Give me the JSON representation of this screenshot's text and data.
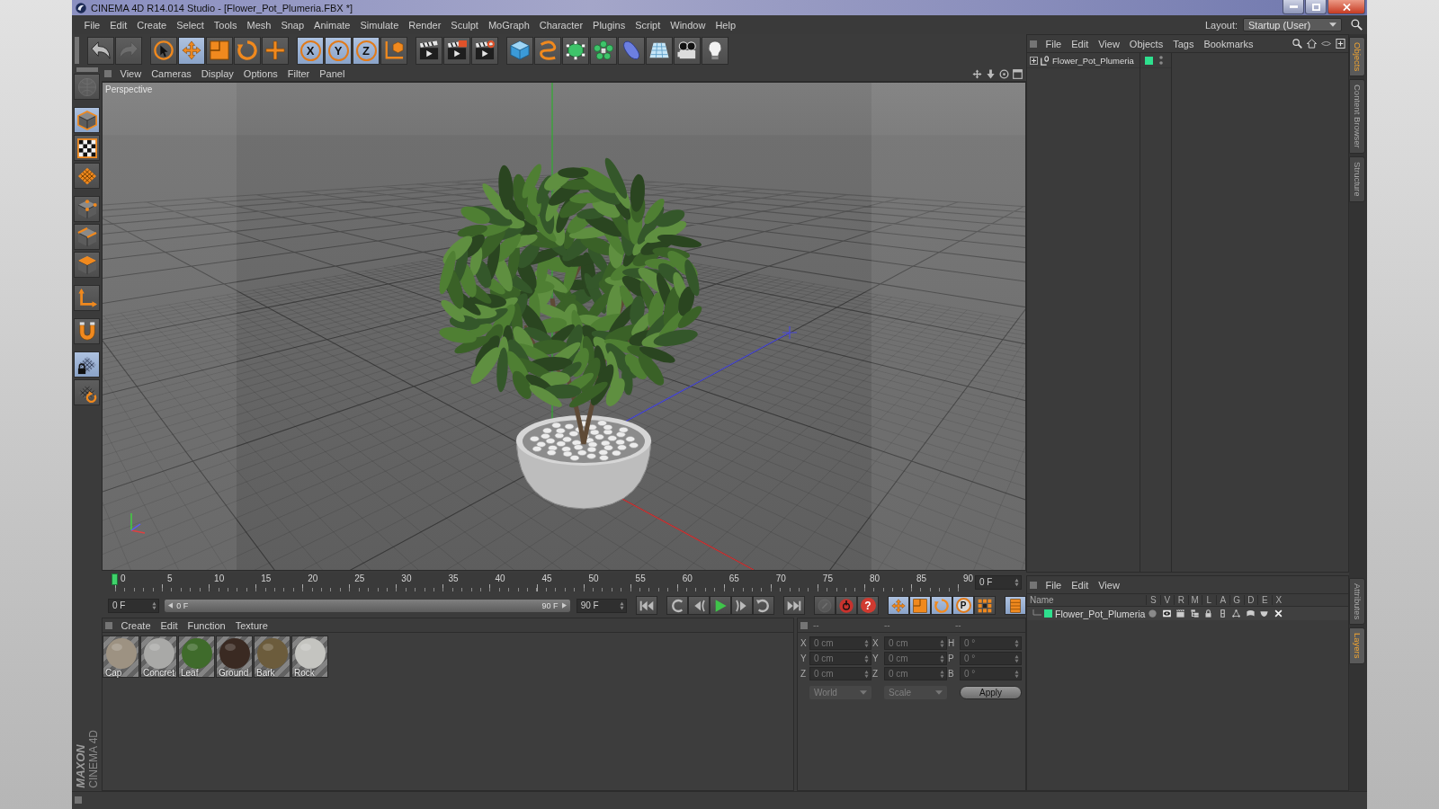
{
  "window": {
    "title": "CINEMA 4D R14.014 Studio - [Flower_Pot_Plumeria.FBX *]"
  },
  "menu_bar": [
    "File",
    "Edit",
    "Create",
    "Select",
    "Tools",
    "Mesh",
    "Snap",
    "Animate",
    "Simulate",
    "Render",
    "Sculpt",
    "MoGraph",
    "Character",
    "Plugins",
    "Script",
    "Window",
    "Help"
  ],
  "layout": {
    "label": "Layout:",
    "value": "Startup (User)"
  },
  "toolbar": [
    [
      {
        "kind": "undo",
        "selected": false,
        "disabled": false
      },
      {
        "kind": "redo",
        "selected": false,
        "disabled": true
      }
    ],
    [
      {
        "kind": "pointer",
        "selected": false,
        "disabled": false
      },
      {
        "kind": "move",
        "selected": true,
        "disabled": false
      },
      {
        "kind": "scale",
        "selected": false,
        "disabled": false
      },
      {
        "kind": "rotate",
        "selected": false,
        "disabled": false
      },
      {
        "kind": "plus",
        "selected": false,
        "disabled": false
      }
    ],
    [
      {
        "kind": "axis",
        "label": "X",
        "selected": true,
        "disabled": false
      },
      {
        "kind": "axis",
        "label": "Y",
        "selected": true,
        "disabled": false
      },
      {
        "kind": "axis",
        "label": "Z",
        "selected": true,
        "disabled": false
      },
      {
        "kind": "coords",
        "selected": false,
        "disabled": false
      }
    ],
    [
      {
        "kind": "renderview",
        "selected": false,
        "disabled": false
      },
      {
        "kind": "renderpicture",
        "selected": false,
        "disabled": false
      },
      {
        "kind": "rendersettings",
        "selected": false,
        "disabled": false
      }
    ],
    [
      {
        "kind": "cube",
        "selected": false,
        "disabled": false
      },
      {
        "kind": "spline",
        "selected": false,
        "disabled": false
      },
      {
        "kind": "subdivision",
        "selected": false,
        "disabled": false
      },
      {
        "kind": "cloner",
        "selected": false,
        "disabled": false
      },
      {
        "kind": "deformer",
        "selected": false,
        "disabled": false
      },
      {
        "kind": "floor",
        "selected": false,
        "disabled": false
      },
      {
        "kind": "camera",
        "selected": false,
        "disabled": false
      },
      {
        "kind": "light",
        "selected": false,
        "disabled": false
      }
    ]
  ],
  "left_toolbar": [
    [
      {
        "kind": "editable",
        "selected": false,
        "disabled": true
      }
    ],
    [
      {
        "kind": "model",
        "selected": true,
        "disabled": false
      },
      {
        "kind": "texture",
        "selected": false,
        "disabled": false
      },
      {
        "kind": "workplane",
        "selected": false,
        "disabled": false
      }
    ],
    [
      {
        "kind": "points",
        "selected": false,
        "disabled": false
      },
      {
        "kind": "edges",
        "selected": false,
        "disabled": false
      },
      {
        "kind": "polygons",
        "selected": false,
        "disabled": false
      }
    ],
    [
      {
        "kind": "axismode",
        "selected": false,
        "disabled": false
      }
    ],
    [
      {
        "kind": "magnet",
        "selected": false,
        "disabled": false
      }
    ],
    [
      {
        "kind": "lockplane",
        "selected": true,
        "disabled": false
      },
      {
        "kind": "snapplane",
        "selected": false,
        "disabled": false
      }
    ]
  ],
  "viewport": {
    "menu": [
      "View",
      "Cameras",
      "Display",
      "Options",
      "Filter",
      "Panel"
    ],
    "camera": "Perspective"
  },
  "timeline": {
    "ticks": [
      "0",
      "5",
      "10",
      "15",
      "20",
      "25",
      "30",
      "35",
      "40",
      "45",
      "50",
      "55",
      "60",
      "65",
      "70",
      "75",
      "80",
      "85",
      "90"
    ],
    "level": 0,
    "frame": "0 F"
  },
  "transport": {
    "current": "0 F",
    "range": {
      "start": "0 F",
      "end": "90 F",
      "level": 1
    },
    "end": "90 F",
    "buttons": [
      [
        {
          "kind": "start",
          "selected": false,
          "disabled": false
        }
      ],
      [
        {
          "kind": "prevkey",
          "selected": false,
          "disabled": false
        },
        {
          "kind": "prevframe",
          "selected": false,
          "disabled": false
        },
        {
          "kind": "play",
          "selected": false,
          "disabled": false
        },
        {
          "kind": "nextframe",
          "selected": false,
          "disabled": false
        },
        {
          "kind": "nextkey",
          "selected": false,
          "disabled": false
        }
      ],
      [
        {
          "kind": "end",
          "selected": false,
          "disabled": false
        }
      ],
      [
        {
          "kind": "keyoff",
          "selected": false,
          "disabled": true
        },
        {
          "kind": "record",
          "selected": false,
          "disabled": false
        },
        {
          "kind": "help",
          "label": "?",
          "selected": false,
          "disabled": false
        }
      ],
      [
        {
          "kind": "keymove",
          "selected": true,
          "disabled": false
        },
        {
          "kind": "keyscale",
          "selected": true,
          "disabled": false
        },
        {
          "kind": "keyrotate",
          "selected": true,
          "disabled": false
        },
        {
          "kind": "param",
          "label": "P",
          "selected": true,
          "disabled": false
        },
        {
          "kind": "pla",
          "selected": false,
          "disabled": false
        }
      ],
      [
        {
          "kind": "timeline",
          "selected": true,
          "disabled": false
        }
      ]
    ]
  },
  "materials": {
    "menu": [
      "Create",
      "Edit",
      "Function",
      "Texture"
    ],
    "items": [
      {
        "name": "Cap",
        "color": "#9d9282"
      },
      {
        "name": "Concret",
        "color": "#a9a9a7"
      },
      {
        "name": "Leaf",
        "color": "#3f6b2b"
      },
      {
        "name": "Ground",
        "color": "#3a2a22"
      },
      {
        "name": "Bark",
        "color": "#6c5c3c"
      },
      {
        "name": "Rock",
        "color": "#c4c4c0"
      }
    ]
  },
  "coordinates": {
    "headers": [
      "--",
      "--",
      "--"
    ],
    "disabled": true,
    "rows": [
      [
        {
          "axis": "X",
          "value": "0 cm"
        },
        {
          "axis": "X",
          "value": "0 cm"
        },
        {
          "axis": "H",
          "value": "0 °"
        }
      ],
      [
        {
          "axis": "Y",
          "value": "0 cm"
        },
        {
          "axis": "Y",
          "value": "0 cm"
        },
        {
          "axis": "P",
          "value": "0 °"
        }
      ],
      [
        {
          "axis": "Z",
          "value": "0 cm"
        },
        {
          "axis": "Z",
          "value": "0 cm"
        },
        {
          "axis": "B",
          "value": "0 °"
        }
      ]
    ],
    "dropdowns": [
      "World",
      "Scale"
    ],
    "apply": "Apply"
  },
  "object_manager": {
    "menu": [
      "File",
      "Edit",
      "View",
      "Objects",
      "Tags",
      "Bookmarks"
    ],
    "objects": [
      {
        "name": "Flower_Pot_Plumeria",
        "expanded": false,
        "color": "#2ee08e"
      }
    ]
  },
  "layer_manager": {
    "menu": [
      "File",
      "Edit",
      "View"
    ],
    "columns": [
      "Name",
      "S",
      "V",
      "R",
      "M",
      "L",
      "A",
      "G",
      "D",
      "E",
      "X"
    ],
    "layers": [
      {
        "name": "Flower_Pot_Plumeria",
        "color": "#2ee08e"
      }
    ]
  },
  "side_tabs": [
    [
      {
        "label": "Objects",
        "selected": true
      },
      {
        "label": "Content Browser",
        "selected": false
      },
      {
        "label": "Structure",
        "selected": false
      }
    ],
    [
      {
        "label": "Attributes",
        "selected": false
      },
      {
        "label": "Layers",
        "selected": true
      }
    ]
  ],
  "brand": {
    "maker": "MAXON",
    "product": "CINEMA 4D"
  }
}
